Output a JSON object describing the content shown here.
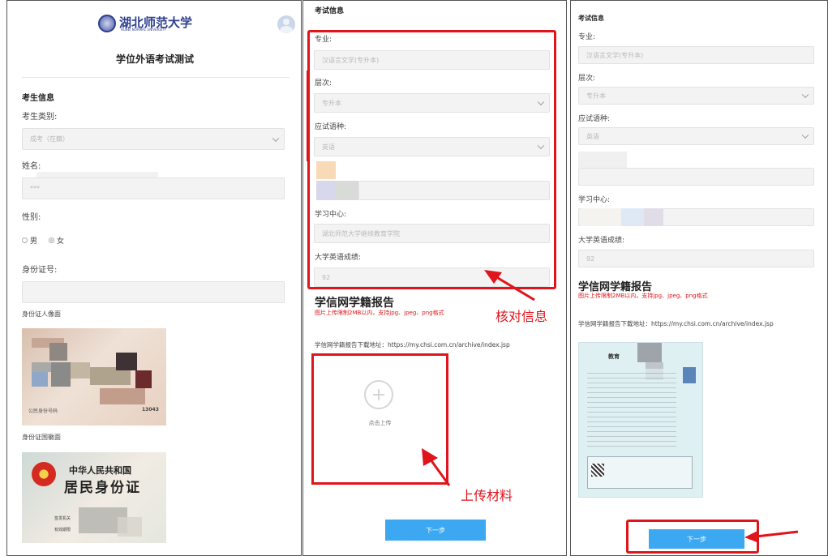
{
  "panel1": {
    "logo_text": "湖北师范大学",
    "logo_sub": "HUBEI NORMAL UNIVERSITY",
    "title": "学位外语考试测试",
    "section_title": "考生信息",
    "category_label": "考生类别:",
    "category_value": "成考（在籍）",
    "name_label": "姓名:",
    "name_value": "***",
    "gender_label": "性别:",
    "gender_male": "男",
    "gender_female": "女",
    "id_label": "身份证号:",
    "id_photo_label": "身份证人像面",
    "id_photo_text": "公民身份号码",
    "id_photo_num": "13043",
    "id_emblem_label": "身份证国徽面",
    "emblem_title1": "中华人民共和国",
    "emblem_title2": "居民身份证",
    "emblem_issuer": "签发机关",
    "emblem_valid": "有效期限"
  },
  "panel2": {
    "section_title": "考试信息",
    "major_label": "专业:",
    "major_value": "汉语言文学(专升本)",
    "level_label": "层次:",
    "level_value": "专升本",
    "lang_label": "应试语种:",
    "lang_value": "英语",
    "center_label": "学习中心:",
    "center_value": "湖北师范大学继续教育学院",
    "score_label": "大学英语成绩:",
    "score_value": "92",
    "report_title": "学信网学籍报告",
    "report_hint": "图片上传限制2MB以内，支持jpg、jpeg、png格式",
    "report_url": "学信网学籍报告下载地址：https://my.chsi.com.cn/archive/index.jsp",
    "upload_text": "点击上传",
    "next_button": "下一步",
    "annot_verify": "核对信息",
    "annot_upload": "上传材料"
  },
  "panel3": {
    "section_title": "考试信息",
    "major_label": "专业:",
    "major_value": "汉语言文学(专升本)",
    "level_label": "层次:",
    "level_value": "专升本",
    "lang_label": "应试语种:",
    "lang_value": "英语",
    "center_label": "学习中心:",
    "score_label": "大学英语成绩:",
    "score_value": "92",
    "report_title": "学信网学籍报告",
    "report_hint": "图片上传限制2MB以内，支持jpg、jpeg、png格式",
    "report_url": "学信网学籍报告下载地址：https://my.chsi.com.cn/archive/index.jsp",
    "doc_title": "教育",
    "next_button": "下一步"
  },
  "colors": {
    "accent": "#3ca8f2",
    "annotation": "#e0141b"
  }
}
